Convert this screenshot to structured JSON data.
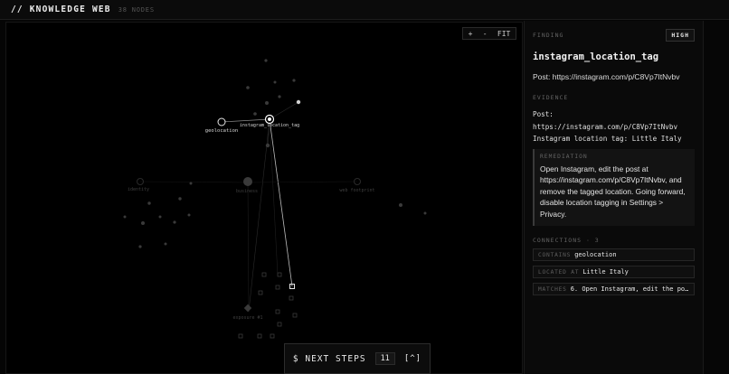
{
  "header": {
    "title": "// KNOWLEDGE WEB",
    "node_count": "38 NODES"
  },
  "graph": {
    "nodes": [
      {
        "label": "geolocation"
      },
      {
        "label": "instagram_location_tag"
      },
      {
        "label": "identity"
      },
      {
        "label": "business"
      },
      {
        "label": "web footprint"
      },
      {
        "label": "exposure #1"
      }
    ]
  },
  "zoom": {
    "plus": "+",
    "minus": "-",
    "fit": "FIT"
  },
  "next_steps": {
    "label": "$ NEXT STEPS",
    "count": "11",
    "toggle": "[^]"
  },
  "panel": {
    "finding_label": "FINDING",
    "severity": "HIGH",
    "title": "instagram_location_tag",
    "post_line": "Post: https://instagram.com/p/C8Vp7ItNvbv",
    "evidence_label": "EVIDENCE",
    "evidence": [
      "Post:",
      "https://instagram.com/p/C8Vp7ItNvbv",
      "Instagram location tag: Little Italy"
    ],
    "remediation_label": "REMEDIATION",
    "remediation_text": "Open Instagram, edit the post at https://instagram.com/p/C8Vp7ItNvbv, and remove the tagged location. Going forward, disable location tagging in Settings > Privacy.",
    "connections_label": "CONNECTIONS · 3",
    "connections": [
      {
        "relation": "CONTAINS",
        "target": "geolocation"
      },
      {
        "relation": "LOCATED AT",
        "target": "Little Italy"
      },
      {
        "relation": "MATCHES",
        "target": "6. Open Instagram, edit the po…"
      }
    ]
  },
  "colors": {
    "background": "#000000",
    "panel": "#0a0a0a",
    "accent": "#ffffff",
    "muted": "#646464"
  }
}
